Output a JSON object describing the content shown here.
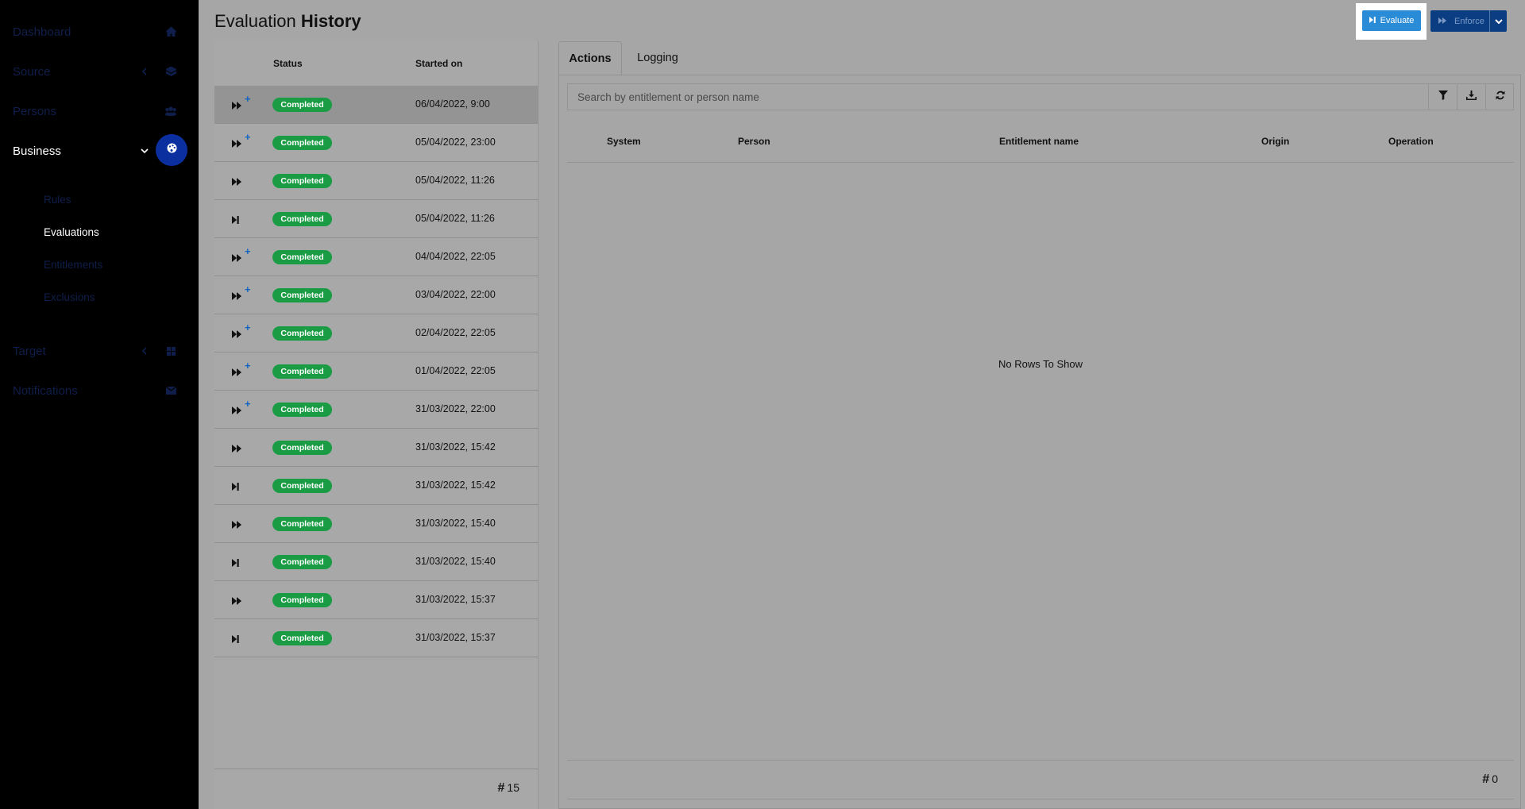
{
  "sidebar": {
    "items": [
      {
        "label": "Dashboard",
        "icon": "home-icon"
      },
      {
        "label": "Source",
        "icon": "layers-icon"
      },
      {
        "label": "Persons",
        "icon": "users-icon"
      },
      {
        "label": "Business",
        "icon": "palette-icon"
      },
      {
        "label": "Target",
        "icon": "grid-icon"
      },
      {
        "label": "Notifications",
        "icon": "envelope-icon"
      }
    ],
    "business_sub": [
      "Rules",
      "Evaluations",
      "Entitlements",
      "Exclusions"
    ]
  },
  "header": {
    "title_light": "Evaluation",
    "title_bold": "History",
    "evaluate_label": "Evaluate",
    "enforce_label": "Enforce"
  },
  "history": {
    "col_status": "Status",
    "col_started": "Started on",
    "rows": [
      {
        "type": "double",
        "plus": true,
        "status": "Completed",
        "started": "06/04/2022, 9:00"
      },
      {
        "type": "double",
        "plus": true,
        "status": "Completed",
        "started": "05/04/2022, 23:00"
      },
      {
        "type": "double",
        "plus": false,
        "status": "Completed",
        "started": "05/04/2022, 11:26"
      },
      {
        "type": "single",
        "plus": false,
        "status": "Completed",
        "started": "05/04/2022, 11:26"
      },
      {
        "type": "double",
        "plus": true,
        "status": "Completed",
        "started": "04/04/2022, 22:05"
      },
      {
        "type": "double",
        "plus": true,
        "status": "Completed",
        "started": "03/04/2022, 22:00"
      },
      {
        "type": "double",
        "plus": true,
        "status": "Completed",
        "started": "02/04/2022, 22:05"
      },
      {
        "type": "double",
        "plus": true,
        "status": "Completed",
        "started": "01/04/2022, 22:05"
      },
      {
        "type": "double",
        "plus": true,
        "status": "Completed",
        "started": "31/03/2022, 22:00"
      },
      {
        "type": "double",
        "plus": false,
        "status": "Completed",
        "started": "31/03/2022, 15:42"
      },
      {
        "type": "single",
        "plus": false,
        "status": "Completed",
        "started": "31/03/2022, 15:42"
      },
      {
        "type": "double",
        "plus": false,
        "status": "Completed",
        "started": "31/03/2022, 15:40"
      },
      {
        "type": "single",
        "plus": false,
        "status": "Completed",
        "started": "31/03/2022, 15:40"
      },
      {
        "type": "double",
        "plus": false,
        "status": "Completed",
        "started": "31/03/2022, 15:37"
      },
      {
        "type": "single",
        "plus": false,
        "status": "Completed",
        "started": "31/03/2022, 15:37"
      }
    ],
    "count_symbol": "#",
    "count": "15"
  },
  "detail": {
    "tabs": [
      "Actions",
      "Logging"
    ],
    "search_placeholder": "Search by entitlement or person name",
    "search_value": "",
    "columns": [
      "System",
      "Person",
      "Entitlement name",
      "Origin",
      "Operation"
    ],
    "empty_text": "No Rows To Show",
    "count_symbol": "#",
    "count": "0"
  },
  "colors": {
    "completed_badge": "#1a9c45",
    "evaluate_button": "#2a8bd6",
    "enforce_button": "#0b3d82",
    "active_nav_circle": "#0b2f9e"
  }
}
